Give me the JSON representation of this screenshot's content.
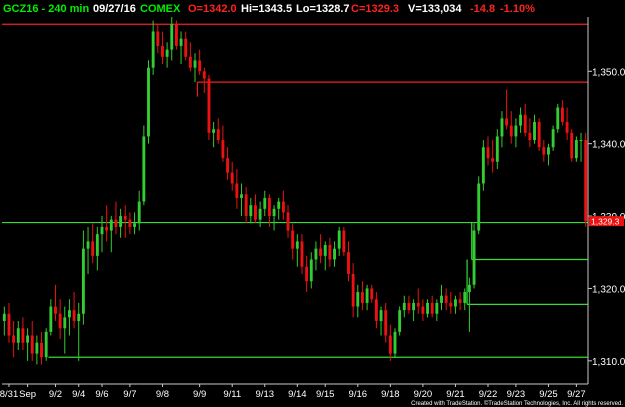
{
  "header": {
    "symbol": "GCZ16 - 240 min",
    "date": "09/27/16",
    "exchange": "COMEX",
    "open": "O=1342.0",
    "high": "Hi=1343.5",
    "low": "Lo=1328.7",
    "close": "C=1329.3",
    "volume": "V=133,034",
    "change": "-14.8",
    "change_pct": "-1.10%"
  },
  "footer": {
    "credit": "Created with TradeStation. ©TradeStation Technologies, Inc. All rights reserved."
  },
  "colors": {
    "up": "#33cc33",
    "down": "#ee1111",
    "support": "#33dd33",
    "resistance": "#ee2222",
    "axis": "#c8c8c8",
    "header_green": "#00ee00",
    "header_red": "#ff2222",
    "header_white": "#ffffff"
  },
  "chart_data": {
    "type": "candlestick",
    "ylim": [
      1306.8,
      1357.5
    ],
    "y_ticks": [
      1310,
      1320,
      1330,
      1340,
      1350
    ],
    "y_tick_labels": [
      "1,310.0",
      "1,320.0",
      "1,330.0",
      "1,340.0",
      "1,350.0"
    ],
    "x_labels": [
      "8/31",
      "Sep",
      "9/2",
      "9/4",
      "9/6",
      "9/7",
      "9/8",
      "9/9",
      "9/11",
      "9/13",
      "9/14",
      "9/15",
      "9/16",
      "9/18",
      "9/20",
      "9/21",
      "9/22",
      "9/23",
      "9/25",
      "9/27"
    ],
    "last_price_label": "1,329.3",
    "last_price": 1329.3,
    "candles": [
      [
        1315.5,
        1317.5,
        1313.5,
        1316.5
      ],
      [
        1316.5,
        1318.0,
        1312.5,
        1313.5
      ],
      [
        1313.5,
        1315.5,
        1310.5,
        1312.5
      ],
      [
        1312.5,
        1315.5,
        1311.5,
        1314.5
      ],
      [
        1314.5,
        1316.0,
        1311.5,
        1312.5
      ],
      [
        1312.5,
        1314.5,
        1310.0,
        1313.5
      ],
      [
        1313.5,
        1315.5,
        1310.0,
        1311.0
      ],
      [
        1311.0,
        1313.5,
        1309.5,
        1312.5
      ],
      [
        1312.5,
        1314.0,
        1309.5,
        1310.5
      ],
      [
        1310.5,
        1314.5,
        1310.0,
        1314.0
      ],
      [
        1314.0,
        1318.5,
        1313.5,
        1317.5
      ],
      [
        1317.5,
        1320.5,
        1315.5,
        1316.5
      ],
      [
        1316.5,
        1318.5,
        1313.0,
        1314.5
      ],
      [
        1314.5,
        1317.5,
        1311.0,
        1316.0
      ],
      [
        1316.0,
        1318.5,
        1313.5,
        1317.0
      ],
      [
        1317.0,
        1319.5,
        1314.5,
        1315.5
      ],
      [
        1315.5,
        1318.0,
        1310.0,
        1316.5
      ],
      [
        1316.5,
        1328.0,
        1315.0,
        1325.5
      ],
      [
        1325.5,
        1328.5,
        1322.0,
        1326.5
      ],
      [
        1326.5,
        1329.0,
        1323.5,
        1324.5
      ],
      [
        1324.5,
        1328.5,
        1322.5,
        1327.5
      ],
      [
        1327.5,
        1330.0,
        1325.0,
        1328.5
      ],
      [
        1328.5,
        1331.5,
        1326.5,
        1328.0
      ],
      [
        1328.0,
        1330.0,
        1325.0,
        1329.5
      ],
      [
        1329.5,
        1332.0,
        1327.5,
        1328.5
      ],
      [
        1328.5,
        1331.0,
        1327.0,
        1330.0
      ],
      [
        1330.0,
        1331.5,
        1327.0,
        1329.5
      ],
      [
        1329.5,
        1330.5,
        1327.5,
        1328.5
      ],
      [
        1328.5,
        1330.5,
        1327.5,
        1329.0
      ],
      [
        1329.0,
        1333.5,
        1328.0,
        1332.0
      ],
      [
        1332.0,
        1342.5,
        1331.5,
        1341.0
      ],
      [
        1341.0,
        1351.5,
        1340.0,
        1350.5
      ],
      [
        1350.5,
        1357.0,
        1349.5,
        1355.5
      ],
      [
        1355.5,
        1356.5,
        1352.5,
        1353.5
      ],
      [
        1353.5,
        1355.5,
        1351.0,
        1352.0
      ],
      [
        1352.0,
        1354.0,
        1350.5,
        1353.0
      ],
      [
        1353.0,
        1357.5,
        1351.5,
        1356.5
      ],
      [
        1356.5,
        1357.0,
        1353.0,
        1353.5
      ],
      [
        1353.5,
        1355.5,
        1351.0,
        1354.5
      ],
      [
        1354.5,
        1355.5,
        1351.5,
        1352.0
      ],
      [
        1352.0,
        1354.0,
        1350.0,
        1350.5
      ],
      [
        1350.5,
        1352.5,
        1348.5,
        1351.5
      ],
      [
        1351.5,
        1353.0,
        1349.5,
        1350.0
      ],
      [
        1350.0,
        1350.5,
        1347.0,
        1349.0
      ],
      [
        1349.0,
        1349.5,
        1340.5,
        1341.5
      ],
      [
        1341.5,
        1343.0,
        1339.5,
        1342.0
      ],
      [
        1342.0,
        1343.5,
        1340.0,
        1340.5
      ],
      [
        1340.5,
        1342.5,
        1337.5,
        1338.0
      ],
      [
        1338.0,
        1339.5,
        1335.0,
        1336.0
      ],
      [
        1336.0,
        1337.5,
        1333.5,
        1334.5
      ],
      [
        1334.5,
        1336.5,
        1331.0,
        1332.5
      ],
      [
        1332.5,
        1334.5,
        1330.0,
        1333.0
      ],
      [
        1333.0,
        1334.0,
        1329.0,
        1330.0
      ],
      [
        1330.0,
        1332.5,
        1329.0,
        1331.5
      ],
      [
        1331.5,
        1333.0,
        1329.0,
        1329.5
      ],
      [
        1329.5,
        1332.0,
        1328.5,
        1331.0
      ],
      [
        1331.0,
        1333.5,
        1330.0,
        1332.5
      ],
      [
        1332.5,
        1333.0,
        1328.5,
        1330.0
      ],
      [
        1330.0,
        1331.5,
        1328.0,
        1331.0
      ],
      [
        1331.0,
        1332.5,
        1329.5,
        1332.0
      ],
      [
        1332.0,
        1333.5,
        1329.5,
        1330.5
      ],
      [
        1330.5,
        1331.5,
        1327.0,
        1328.0
      ],
      [
        1328.0,
        1329.0,
        1324.0,
        1325.5
      ],
      [
        1325.5,
        1327.5,
        1323.0,
        1326.5
      ],
      [
        1326.5,
        1327.5,
        1322.0,
        1323.0
      ],
      [
        1323.0,
        1324.5,
        1319.5,
        1321.0
      ],
      [
        1321.0,
        1325.0,
        1320.0,
        1324.0
      ],
      [
        1324.0,
        1326.5,
        1322.5,
        1325.5
      ],
      [
        1325.5,
        1327.5,
        1323.5,
        1324.5
      ],
      [
        1324.5,
        1326.5,
        1322.5,
        1326.0
      ],
      [
        1326.0,
        1327.0,
        1323.0,
        1324.0
      ],
      [
        1324.0,
        1326.5,
        1323.0,
        1325.5
      ],
      [
        1325.5,
        1328.5,
        1324.5,
        1328.0
      ],
      [
        1328.0,
        1328.5,
        1324.5,
        1325.0
      ],
      [
        1325.0,
        1326.5,
        1321.0,
        1322.0
      ],
      [
        1322.0,
        1323.5,
        1316.0,
        1317.5
      ],
      [
        1317.5,
        1320.5,
        1316.0,
        1319.5
      ],
      [
        1319.5,
        1321.0,
        1317.0,
        1318.0
      ],
      [
        1318.0,
        1320.5,
        1317.0,
        1320.0
      ],
      [
        1320.0,
        1320.5,
        1318.0,
        1318.5
      ],
      [
        1318.5,
        1319.5,
        1314.5,
        1315.5
      ],
      [
        1315.5,
        1317.5,
        1313.5,
        1317.0
      ],
      [
        1317.0,
        1318.0,
        1312.5,
        1313.5
      ],
      [
        1313.5,
        1315.0,
        1310.0,
        1311.0
      ],
      [
        1311.0,
        1314.5,
        1310.5,
        1314.0
      ],
      [
        1314.0,
        1317.5,
        1313.5,
        1317.0
      ],
      [
        1317.0,
        1319.0,
        1316.0,
        1318.0
      ],
      [
        1318.0,
        1319.0,
        1316.5,
        1317.0
      ],
      [
        1317.0,
        1318.5,
        1315.5,
        1318.0
      ],
      [
        1318.0,
        1320.0,
        1316.5,
        1317.5
      ],
      [
        1317.5,
        1318.5,
        1315.5,
        1316.5
      ],
      [
        1316.5,
        1318.5,
        1316.0,
        1318.0
      ],
      [
        1318.0,
        1319.0,
        1316.0,
        1316.5
      ],
      [
        1316.5,
        1318.5,
        1315.5,
        1318.0
      ],
      [
        1318.0,
        1320.5,
        1317.0,
        1319.0
      ],
      [
        1319.0,
        1320.0,
        1317.0,
        1318.0
      ],
      [
        1318.0,
        1319.5,
        1316.5,
        1317.5
      ],
      [
        1317.5,
        1319.0,
        1316.5,
        1318.5
      ],
      [
        1318.5,
        1319.5,
        1317.0,
        1318.0
      ],
      [
        1318.0,
        1320.0,
        1317.0,
        1319.5
      ],
      [
        1319.5,
        1321.5,
        1314.0,
        1320.5
      ],
      [
        1320.5,
        1329.0,
        1320.0,
        1328.0
      ],
      [
        1328.0,
        1335.5,
        1327.5,
        1334.5
      ],
      [
        1334.5,
        1340.5,
        1333.5,
        1339.5
      ],
      [
        1339.5,
        1341.0,
        1337.0,
        1338.0
      ],
      [
        1338.0,
        1340.5,
        1336.0,
        1337.5
      ],
      [
        1337.5,
        1342.0,
        1336.5,
        1341.0
      ],
      [
        1341.0,
        1344.5,
        1339.5,
        1343.5
      ],
      [
        1343.5,
        1347.5,
        1342.0,
        1342.5
      ],
      [
        1342.5,
        1344.5,
        1340.0,
        1341.0
      ],
      [
        1341.0,
        1343.5,
        1339.5,
        1342.5
      ],
      [
        1342.5,
        1345.0,
        1341.5,
        1344.0
      ],
      [
        1344.0,
        1345.5,
        1341.0,
        1341.5
      ],
      [
        1341.5,
        1343.5,
        1339.5,
        1340.5
      ],
      [
        1340.5,
        1344.0,
        1340.0,
        1343.0
      ],
      [
        1343.0,
        1343.5,
        1339.0,
        1339.5
      ],
      [
        1339.5,
        1340.5,
        1337.5,
        1338.5
      ],
      [
        1338.5,
        1340.0,
        1337.0,
        1339.5
      ],
      [
        1339.5,
        1342.5,
        1339.0,
        1342.0
      ],
      [
        1342.0,
        1345.5,
        1341.5,
        1345.0
      ],
      [
        1345.0,
        1346.0,
        1342.5,
        1343.0
      ],
      [
        1343.0,
        1345.0,
        1340.5,
        1341.5
      ],
      [
        1341.5,
        1342.0,
        1337.5,
        1338.0
      ],
      [
        1338.0,
        1341.0,
        1337.5,
        1340.5
      ],
      [
        1340.5,
        1341.5,
        1337.5,
        1340.5
      ],
      [
        1340.5,
        1341.5,
        1328.5,
        1329.3
      ]
    ],
    "levels": [
      {
        "kind": "resistance",
        "price": 1356.5,
        "start_index": 0
      },
      {
        "kind": "resistance",
        "price": 1348.5,
        "start_index": 42
      },
      {
        "kind": "support",
        "price": 1329.1,
        "start_index": 0
      },
      {
        "kind": "support",
        "price": 1324.0,
        "start_index": 101
      },
      {
        "kind": "support",
        "price": 1317.8,
        "start_index": 100
      },
      {
        "kind": "support",
        "price": 1310.5,
        "start_index": 10
      }
    ]
  }
}
